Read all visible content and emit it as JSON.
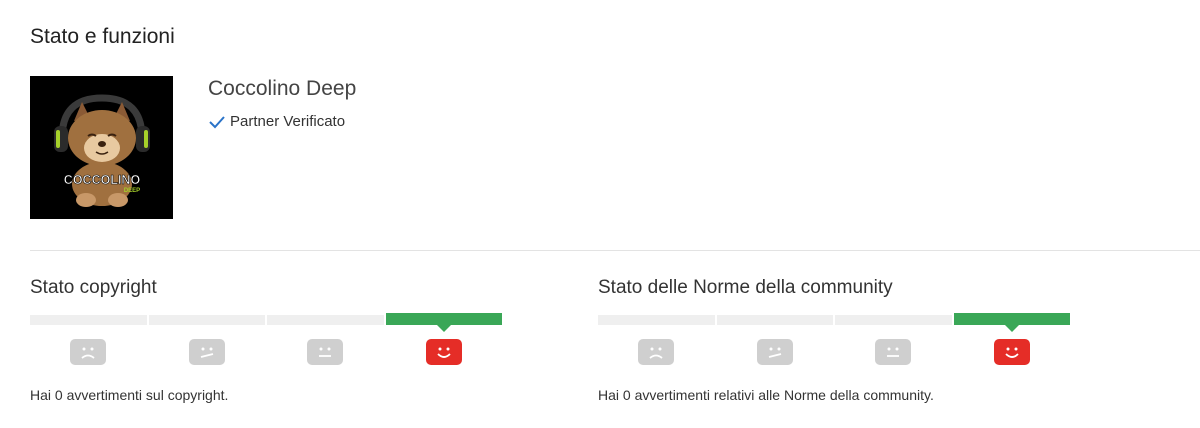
{
  "page": {
    "title": "Stato e funzioni"
  },
  "channel": {
    "name": "Coccolino Deep",
    "partner_label": "Partner Verificato",
    "logo": {
      "line1": "COCCOLINO",
      "line2": "DEEP"
    }
  },
  "copyright": {
    "title": "Stato copyright",
    "message": "Hai 0 avvertimenti sul copyright.",
    "active_level": 4
  },
  "community": {
    "title": "Stato delle Norme della community",
    "message": "Hai 0 avvertimenti relativi alle Norme della community.",
    "active_level": 4
  },
  "colors": {
    "active_bar": "#3aa757",
    "active_face": "#e52d27",
    "inactive_face": "#cfcfcf",
    "check": "#2a73c8"
  },
  "icons": [
    "check-icon",
    "frown-face-icon",
    "skeptical-face-icon",
    "neutral-face-icon",
    "smile-face-icon"
  ]
}
